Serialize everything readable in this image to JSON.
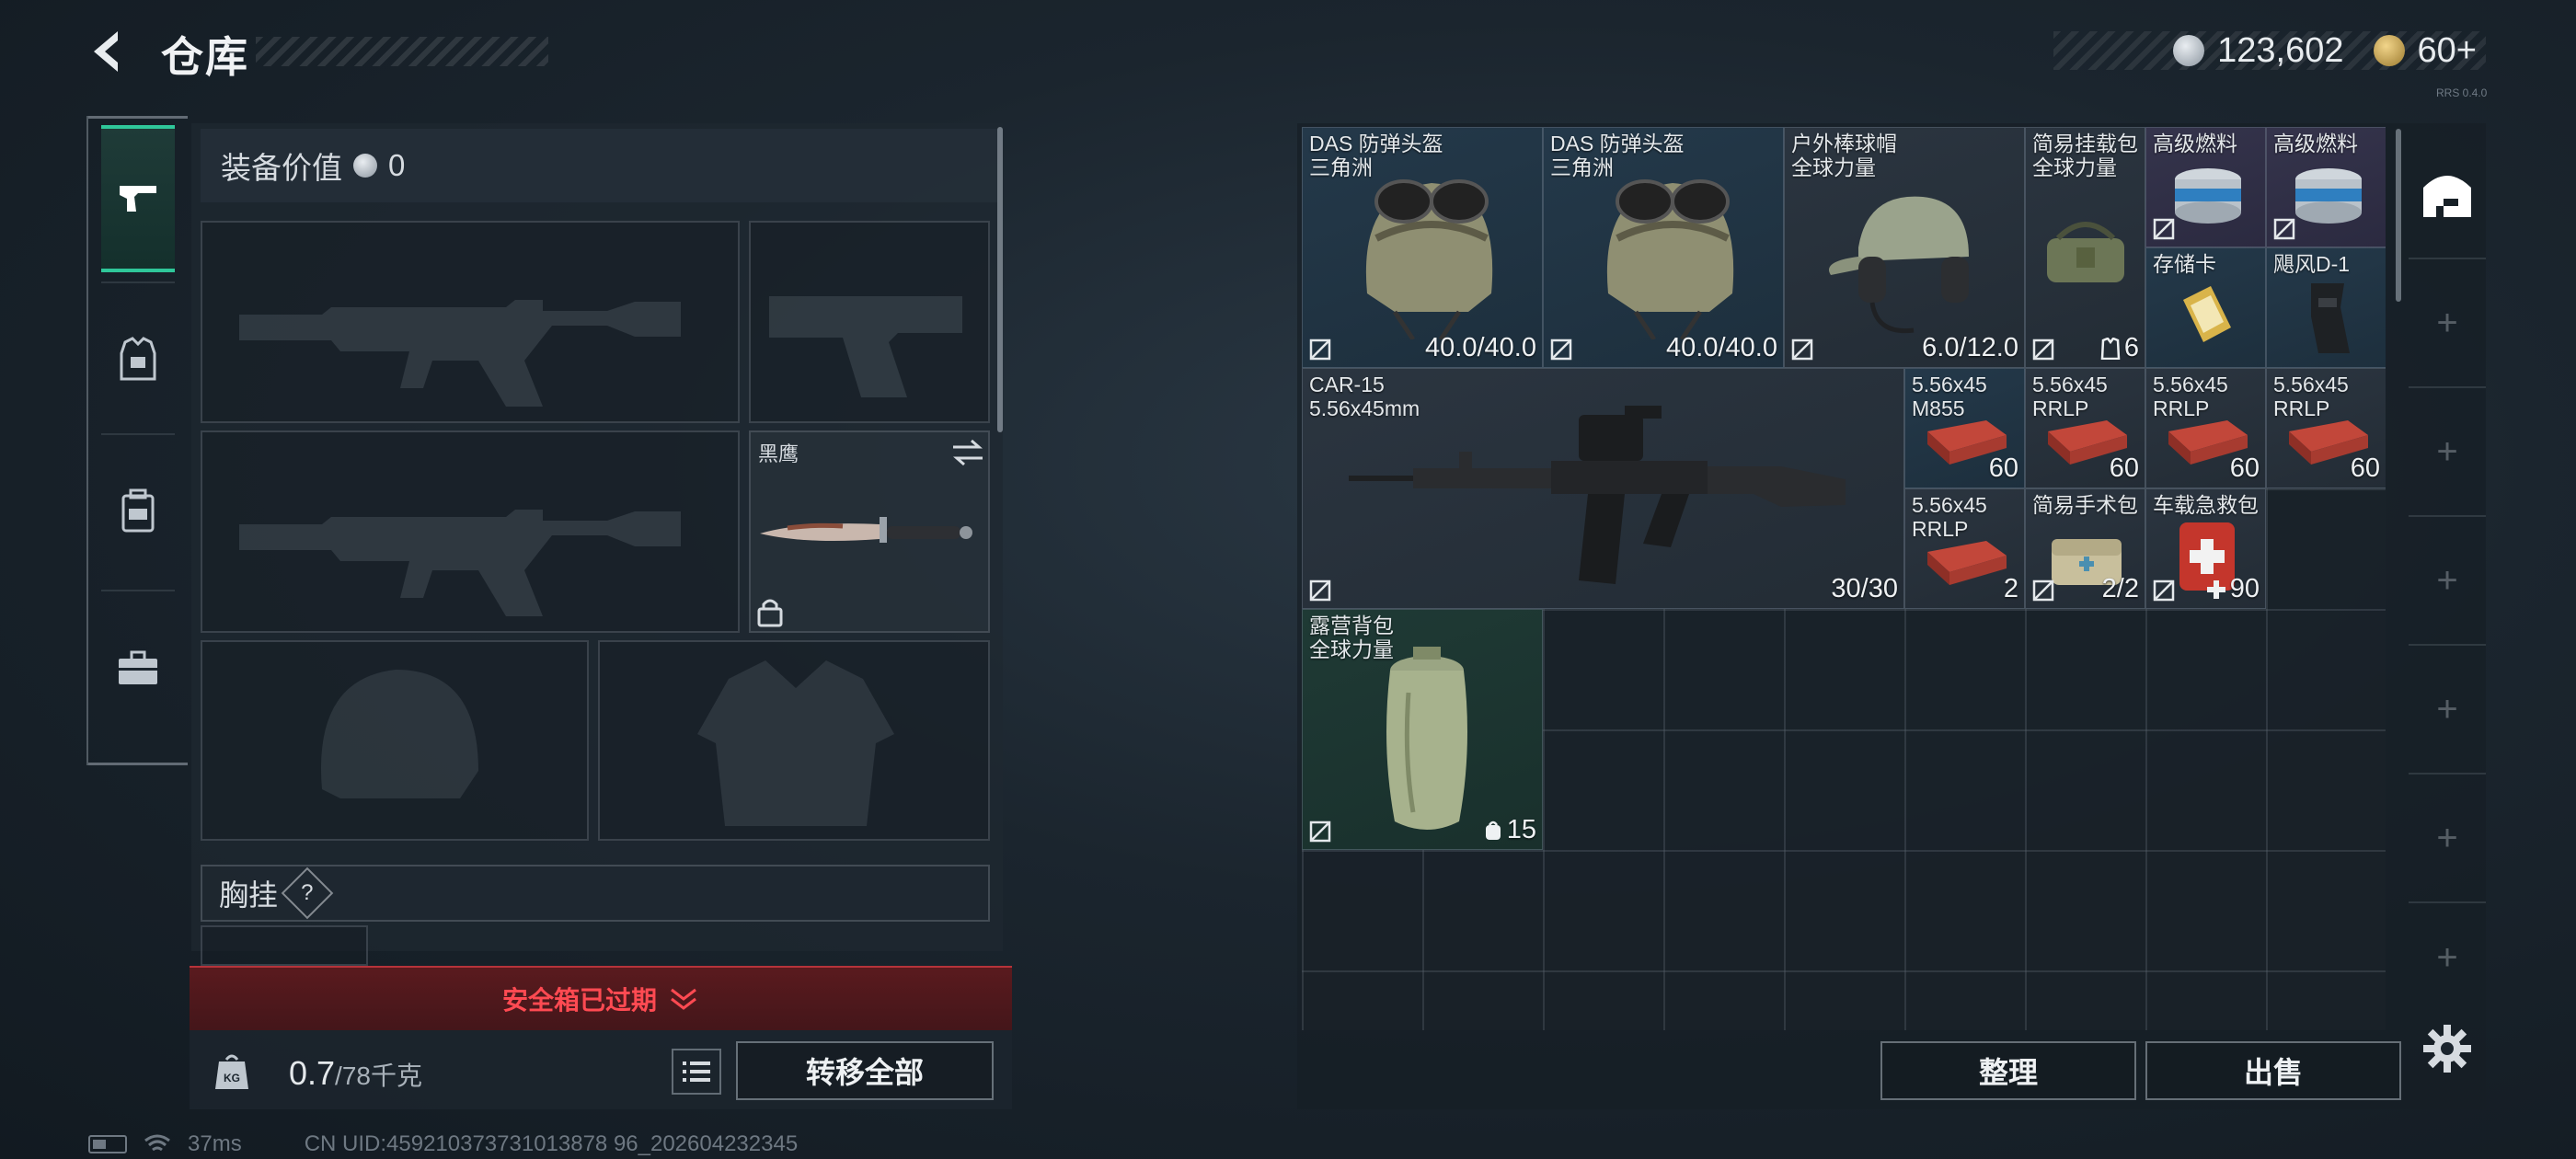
{
  "header": {
    "title": "仓库"
  },
  "currency": {
    "silver": "123,602",
    "gold": "60+",
    "plus": "+"
  },
  "version": "RRS 0.4.0",
  "equip": {
    "value_label": "装备价值",
    "value": "0",
    "melee_label": "黑鹰",
    "chest_label": "胸挂",
    "chest_help": "?"
  },
  "safe_box": {
    "text": "安全箱已过期"
  },
  "weight": {
    "current": "0.7",
    "max": "/78千克"
  },
  "buttons": {
    "transfer_all": "转移全部",
    "sort": "整理",
    "sell": "出售"
  },
  "footer": {
    "ping": "37ms",
    "uid": "CN UID:459210373731013878 96_202604232345"
  },
  "items": [
    {
      "id": "helmet1",
      "name": "DAS 防弹头盔\n三角洲",
      "qty": "40.0/40.0",
      "icon": "helmet"
    },
    {
      "id": "helmet2",
      "name": "DAS 防弹头盔\n三角洲",
      "qty": "40.0/40.0",
      "icon": "helmet"
    },
    {
      "id": "cap",
      "name": "户外棒球帽\n全球力量",
      "qty": "6.0/12.0",
      "icon": "cap-headset"
    },
    {
      "id": "sling",
      "name": "简易挂载包\n全球力量",
      "qty": "6",
      "icon": "bag"
    },
    {
      "id": "fuel1",
      "name": "高级燃料",
      "qty": "",
      "icon": "fuel-can"
    },
    {
      "id": "fuel2",
      "name": "高级燃料",
      "qty": "",
      "icon": "fuel-can"
    },
    {
      "id": "sdcard",
      "name": "存储卡",
      "qty": "",
      "icon": "memory-card"
    },
    {
      "id": "typhoon",
      "name": "飓风D-1",
      "qty": "",
      "icon": "holster"
    },
    {
      "id": "car15",
      "name": "CAR-15\n5.56x45mm",
      "qty": "30/30",
      "icon": "rifle"
    },
    {
      "id": "ammo1",
      "name": "5.56x45\nM855",
      "qty": "60",
      "icon": "ammo-box"
    },
    {
      "id": "ammo2",
      "name": "5.56x45\nRRLP",
      "qty": "60",
      "icon": "ammo-box"
    },
    {
      "id": "ammo3",
      "name": "5.56x45\nRRLP",
      "qty": "60",
      "icon": "ammo-box"
    },
    {
      "id": "ammo4",
      "name": "5.56x45\nRRLP",
      "qty": "60",
      "icon": "ammo-box"
    },
    {
      "id": "ammo5",
      "name": "5.56x45\nRRLP",
      "qty": "2",
      "icon": "ammo-box"
    },
    {
      "id": "surgery",
      "name": "简易手术包",
      "qty": "2/2",
      "icon": "surgery-kit"
    },
    {
      "id": "firstaid",
      "name": "车载急救包",
      "qty": "90",
      "icon": "first-aid"
    },
    {
      "id": "backpack",
      "name": "露营背包\n全球力量",
      "qty": "15",
      "icon": "backpack"
    }
  ],
  "colors": {
    "accent": "#2fc79a",
    "warning": "#ff4a52",
    "rarity_blue": "#24394a",
    "rarity_purple": "#35344c",
    "rarity_green": "#1f3a35"
  }
}
